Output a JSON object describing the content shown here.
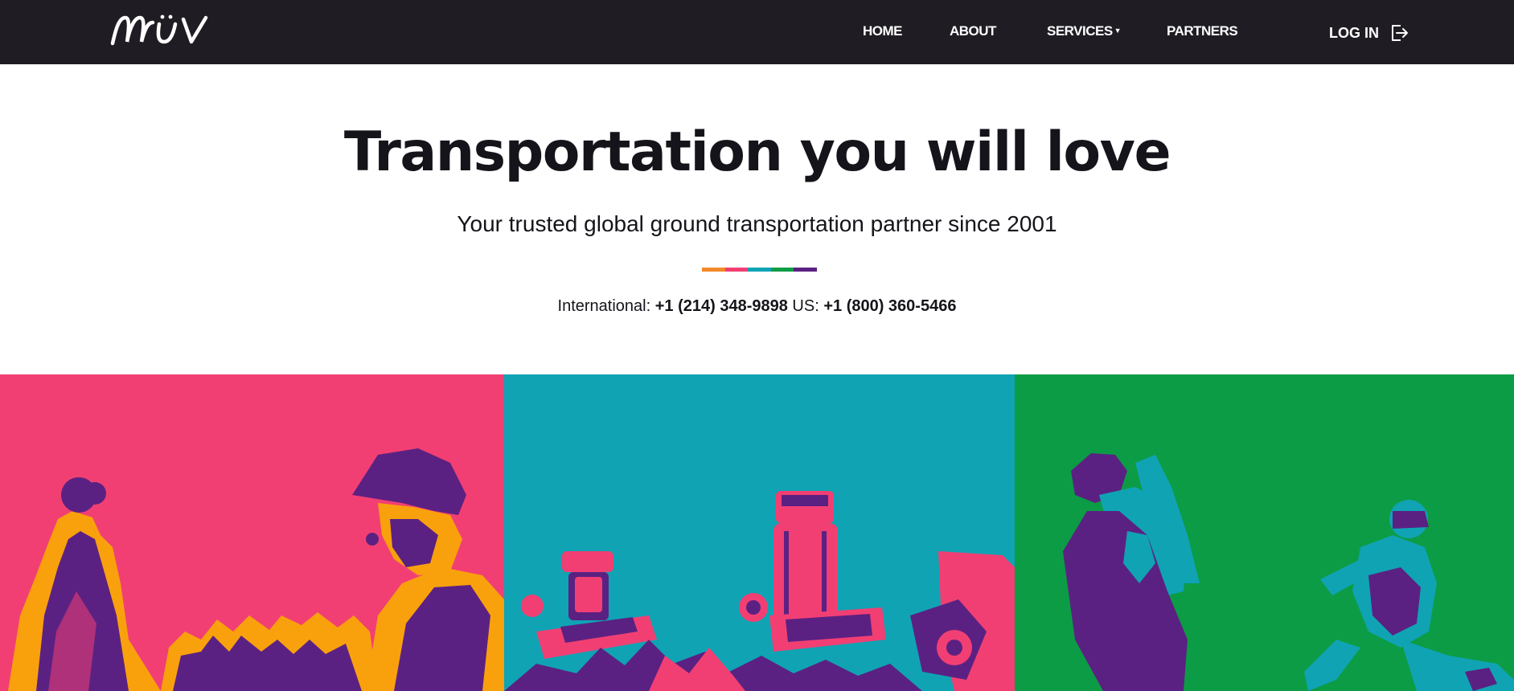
{
  "header": {
    "logo_text": "MUV",
    "nav": [
      {
        "label": "HOME"
      },
      {
        "label": "ABOUT"
      },
      {
        "label": "SERVICES",
        "has_dropdown": true
      },
      {
        "label": "PARTNERS"
      }
    ],
    "login_label": "LOG IN"
  },
  "hero": {
    "title": "Transportation you will love",
    "subtitle": "Your trusted global ground transportation partner since 2001",
    "divider_colors": [
      "#f2892a",
      "#f23f73",
      "#10a3b4",
      "#0c9c45",
      "#5b2182"
    ],
    "phones": {
      "intl_label": "International:",
      "intl_number": "+1 (214) 348-9898",
      "us_label": "US:",
      "us_number": "+1 (800) 360-5466"
    }
  },
  "panels": [
    {
      "name": "people-panel",
      "bg": "#f23f73"
    },
    {
      "name": "medical-panel",
      "bg": "#10a3b4"
    },
    {
      "name": "sports-panel",
      "bg": "#0c9c45"
    }
  ],
  "colors": {
    "topbar": "#1f1d23",
    "purple": "#5b2182",
    "orange": "#f9a10d",
    "pink": "#f23f73",
    "teal": "#10a3b4"
  }
}
